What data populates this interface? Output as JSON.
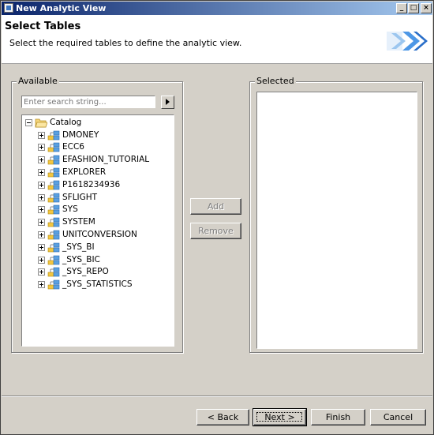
{
  "window": {
    "title": "New Analytic View"
  },
  "header": {
    "title": "Select Tables",
    "description": "Select the required tables to define the analytic view."
  },
  "available": {
    "label": "Available",
    "search": {
      "placeholder": "Enter search string...",
      "value": ""
    },
    "tree": {
      "root": {
        "label": "Catalog",
        "expanded": true
      },
      "schemas": [
        {
          "label": "DMONEY"
        },
        {
          "label": "ECC6"
        },
        {
          "label": "EFASHION_TUTORIAL"
        },
        {
          "label": "EXPLORER"
        },
        {
          "label": "P1618234936"
        },
        {
          "label": "SFLIGHT"
        },
        {
          "label": "SYS"
        },
        {
          "label": "SYSTEM"
        },
        {
          "label": "UNITCONVERSION"
        },
        {
          "label": "_SYS_BI"
        },
        {
          "label": "_SYS_BIC"
        },
        {
          "label": "_SYS_REPO"
        },
        {
          "label": "_SYS_STATISTICS"
        }
      ]
    }
  },
  "transfer": {
    "add_label": "Add",
    "remove_label": "Remove"
  },
  "selected": {
    "label": "Selected",
    "items": []
  },
  "footer": {
    "back_label": "< Back",
    "next_label": "Next >",
    "finish_label": "Finish",
    "cancel_label": "Cancel"
  },
  "icons": {
    "window": "app-icon",
    "banner": "wizard-arrows-icon",
    "search_go": "play-arrow-icon",
    "root": "open-folder-icon",
    "schema": "schema-icon"
  },
  "colors": {
    "titlebar_start": "#0a246a",
    "titlebar_end": "#a6caf0",
    "dialog_bg": "#d4d0c8",
    "banner_blue": "#4d97e6"
  }
}
